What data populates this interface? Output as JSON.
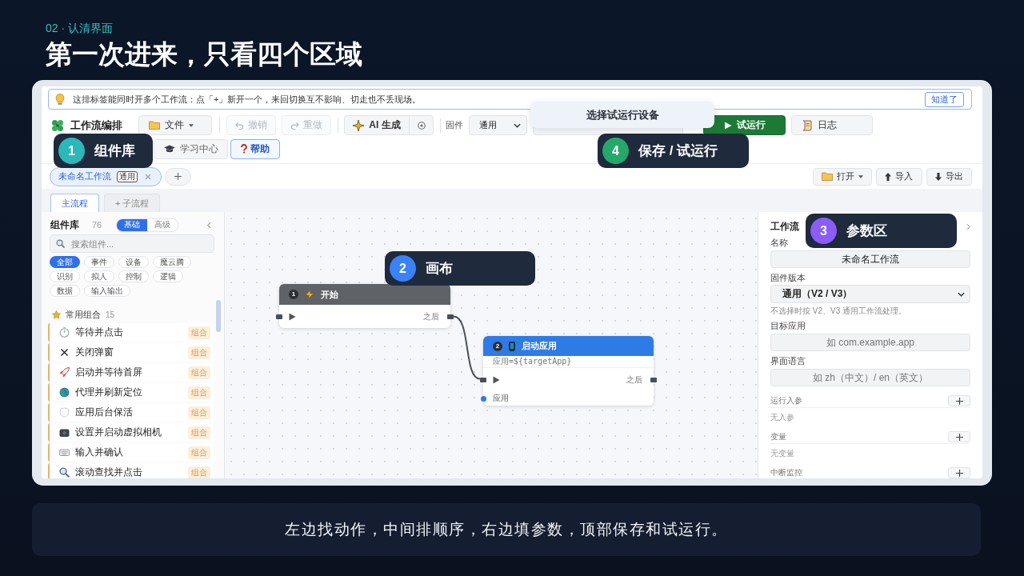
{
  "header": {
    "section": "02 · 认清界面",
    "title": "第一次进来，只看四个区域"
  },
  "app": {
    "tip": {
      "text": "这排标签能同时开多个工作流：点「+」新开一个，来回切换互不影响、切走也不丢现场。",
      "button": "知道了"
    },
    "toolbar": {
      "title": "工作流编排",
      "file_menu": "文件",
      "history": [
        {
          "label": "撤销",
          "kind": "undo",
          "disabled": true
        },
        {
          "label": "重做",
          "kind": "redo",
          "disabled": true
        }
      ],
      "ai_button": "AI 生成",
      "firmware_label": "固件",
      "firmware_value": "通用",
      "run_button": "试运行",
      "log_button": "日志",
      "learn_button": "学习中心",
      "help_button": "帮助"
    },
    "device_popover": "选择试运行设备",
    "workflow_tabs": [
      {
        "label": "未命名工作流",
        "badge": "通用",
        "selected": true
      }
    ],
    "file_actions": [
      {
        "label": "打开",
        "kind": "menu"
      },
      {
        "label": "导入",
        "kind": "import"
      },
      {
        "label": "导出",
        "kind": "export"
      }
    ],
    "flow_tabs": [
      {
        "label": "主流程",
        "selected": true
      },
      {
        "label": "+ 子流程",
        "selected": false
      }
    ],
    "library": {
      "title": "组件库",
      "count": "76",
      "modes": [
        {
          "label": "基础",
          "selected": true
        },
        {
          "label": "高级",
          "selected": false
        }
      ],
      "search_placeholder": "搜索组件...",
      "filters": [
        {
          "label": "全部",
          "selected": true
        },
        {
          "label": "事件",
          "selected": false
        },
        {
          "label": "设备",
          "selected": false
        },
        {
          "label": "魔云腾",
          "selected": false
        },
        {
          "label": "识别",
          "selected": false
        },
        {
          "label": "拟人",
          "selected": false
        },
        {
          "label": "控制",
          "selected": false
        },
        {
          "label": "逻辑",
          "selected": false
        },
        {
          "label": "数据",
          "selected": false
        },
        {
          "label": "输入输出",
          "selected": false
        }
      ],
      "section": {
        "title": "常用组合",
        "count": "15"
      },
      "items": [
        {
          "name": "等待并点击",
          "badge": "组合"
        },
        {
          "name": "关闭弹窗",
          "badge": "组合"
        },
        {
          "name": "启动并等待首屏",
          "badge": "组合"
        },
        {
          "name": "代理并刷新定位",
          "badge": "组合"
        },
        {
          "name": "应用后台保活",
          "badge": "组合"
        },
        {
          "name": "设置并启动虚拟相机",
          "badge": "组合"
        },
        {
          "name": "输入并确认",
          "badge": "组合"
        },
        {
          "name": "滚动查找并点击",
          "badge": "组合"
        }
      ]
    },
    "canvas": {
      "nodes": [
        {
          "number": "1",
          "kind": "start",
          "title": "开始",
          "output": "之后"
        },
        {
          "number": "2",
          "kind": "action",
          "title": "启动应用",
          "param": "应用=${targetApp}",
          "output": "之后",
          "inputs": [
            "应用"
          ]
        }
      ]
    },
    "properties": {
      "title": "工作流",
      "fields": [
        {
          "label": "名称",
          "kind": "input",
          "value": "未命名工作流"
        },
        {
          "label": "固件版本",
          "kind": "select",
          "value": "通用（V2 / V3）",
          "hint": "不选择时按 V2、V3 通用工作流处理。"
        },
        {
          "label": "目标应用",
          "kind": "input",
          "placeholder": "如 com.example.app"
        },
        {
          "label": "界面语言",
          "kind": "input",
          "placeholder": "如 zh（中文）/ en（英文）"
        }
      ],
      "sections": [
        {
          "title": "运行入参",
          "empty": "无入参"
        },
        {
          "title": "变量",
          "empty": "无变量"
        },
        {
          "title": "中断监控"
        }
      ]
    }
  },
  "callouts": [
    {
      "number": "1",
      "label": "组件库",
      "color": "#2bb8b8"
    },
    {
      "number": "2",
      "label": "画布",
      "color": "#3b82f6"
    },
    {
      "number": "3",
      "label": "参数区",
      "color": "#8b5cf6"
    },
    {
      "number": "4",
      "label": "保存 / 试运行",
      "color": "#25a86b"
    }
  ],
  "caption": "左边找动作，中间排顺序，右边填参数，顶部保存和试运行。"
}
